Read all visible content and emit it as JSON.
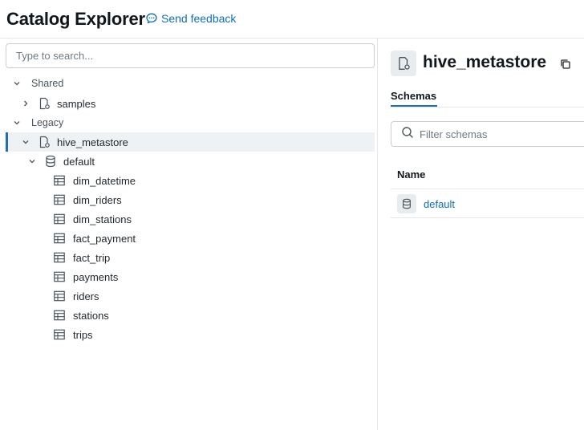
{
  "header": {
    "title": "Catalog Explorer",
    "feedback_label": "Send feedback"
  },
  "sidebar": {
    "search_placeholder": "Type to search...",
    "sections": {
      "shared": {
        "label": "Shared",
        "items": [
          {
            "label": "samples",
            "icon": "catalog-icon",
            "expanded": false
          }
        ]
      },
      "legacy": {
        "label": "Legacy",
        "catalog": {
          "label": "hive_metastore",
          "icon": "catalog-icon",
          "expanded": true,
          "selected": true,
          "schema": {
            "label": "default",
            "icon": "database-icon",
            "expanded": true,
            "tables": [
              "dim_datetime",
              "dim_riders",
              "dim_stations",
              "fact_payment",
              "fact_trip",
              "payments",
              "riders",
              "stations",
              "trips"
            ]
          }
        }
      }
    }
  },
  "detail": {
    "title": "hive_metastore",
    "tabs": [
      "Schemas"
    ],
    "active_tab": "Schemas",
    "filter_placeholder": "Filter schemas",
    "table": {
      "columns": [
        "Name"
      ],
      "rows": [
        {
          "name": "default",
          "icon": "database-icon"
        }
      ]
    }
  },
  "colors": {
    "accent": "#1f6fb5",
    "link": "#0e6fb8",
    "selected_bg": "#eef2f5",
    "border": "#e4e6e8"
  }
}
